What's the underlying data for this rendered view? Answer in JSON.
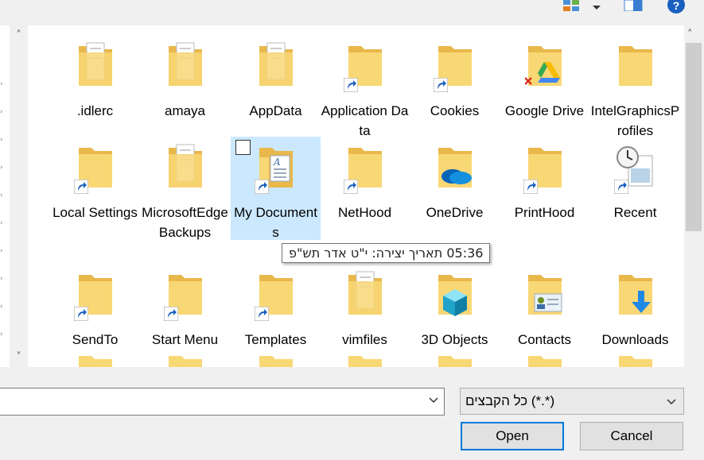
{
  "toolbar": {
    "view_icon": "view-options-icon",
    "view_dropdown_icon": "dropdown-arrow-icon",
    "pane_icon": "preview-pane-icon",
    "help_icon": "help-icon"
  },
  "items": [
    {
      "label": ".idlerc",
      "icon": "folder-documents",
      "shortcut": false
    },
    {
      "label": "amaya",
      "icon": "folder-documents",
      "shortcut": false
    },
    {
      "label": "AppData",
      "icon": "folder-documents",
      "shortcut": false
    },
    {
      "label": "Application Data",
      "icon": "folder",
      "shortcut": true
    },
    {
      "label": "Cookies",
      "icon": "folder",
      "shortcut": true
    },
    {
      "label": "Google Drive",
      "icon": "google-drive",
      "shortcut": false
    },
    {
      "label": "IntelGraphicsProfiles",
      "icon": "folder",
      "shortcut": false
    },
    {
      "label": "Local Settings",
      "icon": "folder",
      "shortcut": true
    },
    {
      "label": "MicrosoftEdgeBackups",
      "icon": "folder-documents",
      "shortcut": false
    },
    {
      "label": "My Documents",
      "icon": "documents",
      "shortcut": true,
      "selected": true
    },
    {
      "label": "NetHood",
      "icon": "folder",
      "shortcut": true
    },
    {
      "label": "OneDrive",
      "icon": "onedrive",
      "shortcut": false
    },
    {
      "label": "PrintHood",
      "icon": "folder",
      "shortcut": true
    },
    {
      "label": "Recent",
      "icon": "recent",
      "shortcut": true
    },
    {
      "label": "SendTo",
      "icon": "folder",
      "shortcut": true
    },
    {
      "label": "Start Menu",
      "icon": "folder",
      "shortcut": true
    },
    {
      "label": "Templates",
      "icon": "folder",
      "shortcut": true
    },
    {
      "label": "vimfiles",
      "icon": "folder-documents",
      "shortcut": false
    },
    {
      "label": "3D Objects",
      "icon": "3d-objects",
      "shortcut": false
    },
    {
      "label": "Contacts",
      "icon": "contacts",
      "shortcut": false
    },
    {
      "label": "Downloads",
      "icon": "downloads",
      "shortcut": false
    }
  ],
  "tooltip": "05:36 תאריך יצירה: י\"ט אדר תש\"פ",
  "filename": {
    "value": "",
    "placeholder": ""
  },
  "filetype": {
    "selected": "כל הקבצים (*.*)"
  },
  "buttons": {
    "open": "Open",
    "cancel": "Cancel"
  },
  "colors": {
    "selection": "#cce8ff",
    "folder": "#f8d775",
    "folder_dark": "#e9b84b",
    "accent": "#0078d7"
  }
}
